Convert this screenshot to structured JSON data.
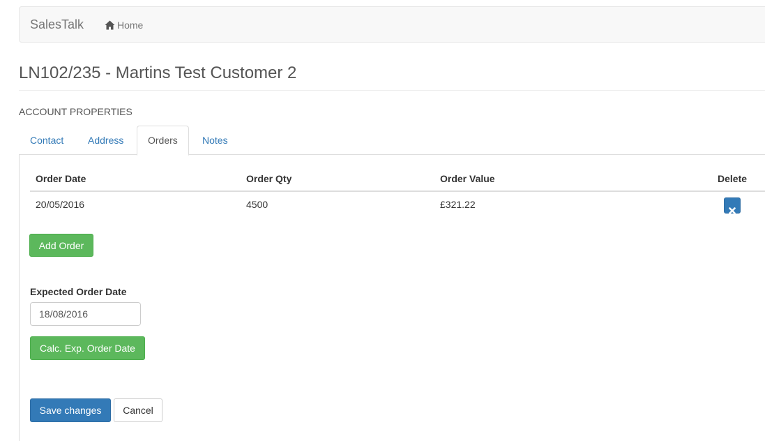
{
  "navbar": {
    "brand": "SalesTalk",
    "home_label": "Home",
    "home_icon": "home-icon"
  },
  "page": {
    "title": "LN102/235 - Martins Test Customer 2",
    "section_label": "ACCOUNT PROPERTIES"
  },
  "tabs": [
    {
      "label": "Contact",
      "active": false
    },
    {
      "label": "Address",
      "active": false
    },
    {
      "label": "Orders",
      "active": true
    },
    {
      "label": "Notes",
      "active": false
    }
  ],
  "orders": {
    "columns": [
      "Order Date",
      "Order Qty",
      "Order Value",
      "Delete"
    ],
    "rows": [
      {
        "date": "20/05/2016",
        "qty": "4500",
        "value": "£321.22",
        "delete_icon": "remove-icon"
      }
    ],
    "add_label": "Add Order"
  },
  "expected_order": {
    "label": "Expected Order Date",
    "value": "18/08/2016",
    "calc_label": "Calc. Exp. Order Date"
  },
  "footer": {
    "save_label": "Save changes",
    "cancel_label": "Cancel"
  },
  "colors": {
    "primary": "#337ab7",
    "success": "#5cb85c",
    "link": "#337ab7",
    "navbar_bg": "#f8f8f8"
  }
}
